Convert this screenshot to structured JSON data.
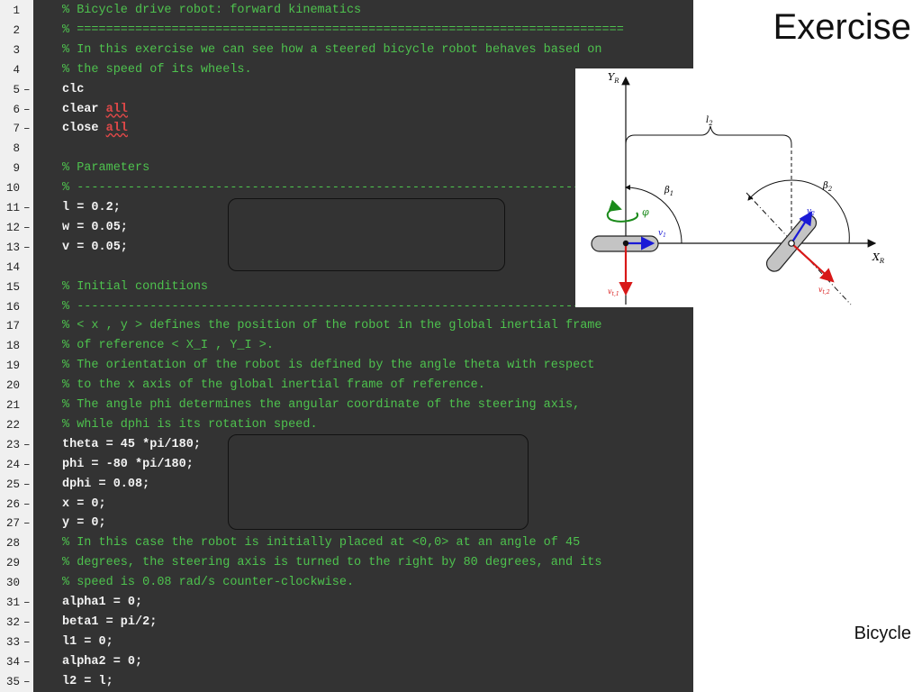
{
  "slide": {
    "title": "Exercise",
    "footer": "Bicycle"
  },
  "code_lines": [
    {
      "n": "1",
      "bp": "",
      "kind": "comment",
      "text": "% Bicycle drive robot: forward kinematics"
    },
    {
      "n": "2",
      "bp": "",
      "kind": "comment",
      "text": "% ==========================================================================="
    },
    {
      "n": "3",
      "bp": "",
      "kind": "comment",
      "text": "% In this exercise we can see how a steered bicycle robot behaves based on"
    },
    {
      "n": "4",
      "bp": "",
      "kind": "comment",
      "text": "% the speed of its wheels."
    },
    {
      "n": "5",
      "bp": "–",
      "kind": "code",
      "text": "clc"
    },
    {
      "n": "6",
      "bp": "–",
      "kind": "code",
      "text": "clear ",
      "kw": "all"
    },
    {
      "n": "7",
      "bp": "–",
      "kind": "code",
      "text": "close ",
      "kw": "all"
    },
    {
      "n": "8",
      "bp": "",
      "kind": "code",
      "text": ""
    },
    {
      "n": "9",
      "bp": "",
      "kind": "comment",
      "text": "% Parameters"
    },
    {
      "n": "10",
      "bp": "",
      "kind": "comment",
      "text": "% -----------------------------------------------------------------------"
    },
    {
      "n": "11",
      "bp": "–",
      "kind": "code",
      "text": "l = 0.2;"
    },
    {
      "n": "12",
      "bp": "–",
      "kind": "code",
      "text": "w = 0.05;"
    },
    {
      "n": "13",
      "bp": "–",
      "kind": "code",
      "text": "v = 0.05;"
    },
    {
      "n": "14",
      "bp": "",
      "kind": "code",
      "text": ""
    },
    {
      "n": "15",
      "bp": "",
      "kind": "comment",
      "text": "% Initial conditions"
    },
    {
      "n": "16",
      "bp": "",
      "kind": "comment",
      "text": "% -----------------------------------------------------------------------"
    },
    {
      "n": "17",
      "bp": "",
      "kind": "comment",
      "text": "% < x , y > defines the position of the robot in the global inertial frame"
    },
    {
      "n": "18",
      "bp": "",
      "kind": "comment",
      "text": "% of reference < X_I , Y_I >."
    },
    {
      "n": "19",
      "bp": "",
      "kind": "comment",
      "text": "% The orientation of the robot is defined by the angle theta with respect"
    },
    {
      "n": "20",
      "bp": "",
      "kind": "comment",
      "text": "% to the x axis of the global inertial frame of reference."
    },
    {
      "n": "21",
      "bp": "",
      "kind": "comment",
      "text": "% The angle phi determines the angular coordinate of the steering axis,"
    },
    {
      "n": "22",
      "bp": "",
      "kind": "comment",
      "text": "% while dphi is its rotation speed."
    },
    {
      "n": "23",
      "bp": "–",
      "kind": "code",
      "text": "theta = 45 *pi/180;"
    },
    {
      "n": "24",
      "bp": "–",
      "kind": "code",
      "text": "phi = -80 *pi/180;"
    },
    {
      "n": "25",
      "bp": "–",
      "kind": "code",
      "text": "dphi = 0.08;"
    },
    {
      "n": "26",
      "bp": "–",
      "kind": "code",
      "text": "x = 0;"
    },
    {
      "n": "27",
      "bp": "–",
      "kind": "code",
      "text": "y = 0;"
    },
    {
      "n": "28",
      "bp": "",
      "kind": "comment",
      "text": "% In this case the robot is initially placed at <0,0> at an angle of 45"
    },
    {
      "n": "29",
      "bp": "",
      "kind": "comment",
      "text": "% degrees, the steering axis is turned to the right by 80 degrees, and its"
    },
    {
      "n": "30",
      "bp": "",
      "kind": "comment",
      "text": "% speed is 0.08 rad/s counter-clockwise."
    },
    {
      "n": "31",
      "bp": "–",
      "kind": "code",
      "text": "alpha1 = 0;"
    },
    {
      "n": "32",
      "bp": "–",
      "kind": "code",
      "text": "beta1 = pi/2;"
    },
    {
      "n": "33",
      "bp": "–",
      "kind": "code",
      "text": "l1 = 0;"
    },
    {
      "n": "34",
      "bp": "–",
      "kind": "code",
      "text": "alpha2 = 0;"
    },
    {
      "n": "35",
      "bp": "–",
      "kind": "code",
      "text": "l2 = l;"
    }
  ],
  "diagram": {
    "y_axis": "Y",
    "y_axis_sub": "R",
    "x_axis": "X",
    "x_axis_sub": "R",
    "length_label": "l",
    "length_sub": "2",
    "beta1": "β",
    "beta1_sub": "1",
    "beta2": "β",
    "beta2_sub": "2",
    "phi": "φ",
    "v1": "v",
    "v1_sub": "1",
    "v2": "v",
    "v2_sub": "2",
    "vt1": "v",
    "vt1_sub": "t,1",
    "vt2": "v",
    "vt2_sub": "t,2"
  },
  "colors": {
    "comment": "#4ec24e",
    "code_text": "#f2f2f2",
    "keyword": "#e04848",
    "editor_bg": "#333333",
    "arrow_blue": "#1a1ad6",
    "arrow_red": "#d81818",
    "arrow_green": "#1a8a1a"
  }
}
